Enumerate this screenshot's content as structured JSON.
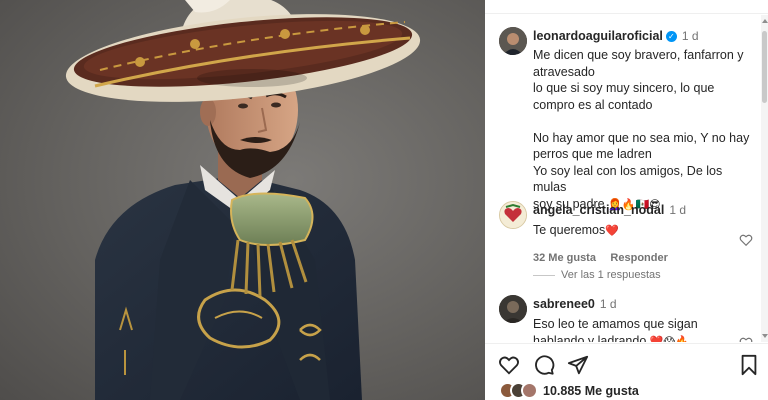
{
  "post": {
    "author": "leonardoaguilaroficial",
    "verified": true,
    "time": "1 d",
    "caption_lines": [
      "Me dicen que soy bravero, fanfarron y",
      "atravesado",
      "lo que si soy muy sincero, lo que",
      "compro es al contado",
      "",
      "No hay amor que no sea mio, Y no hay",
      "perros que me ladren",
      "Yo soy leal con los amigos, De los mulas",
      "soy su padre"
    ],
    "caption_emoji": "👩‍🦰🔥🇲🇽😎"
  },
  "comments": [
    {
      "user": "angela_cristian_nodal",
      "time": "1 d",
      "text": "Te queremos",
      "emoji": "❤️",
      "likes": "32 Me gusta",
      "reply_label": "Responder",
      "view_replies": "Ver las 1 respuestas"
    },
    {
      "user": "sabrenee0",
      "time": "1 d",
      "text_lines": [
        "Eso leo te amamos que sigan",
        "hablando y ladrando"
      ],
      "emoji": "❤️😱🔥"
    }
  ],
  "actions": {
    "like_count": "10.885 Me gusta"
  },
  "icons": [
    "verified-badge-icon",
    "heart-icon",
    "comment-icon",
    "share-icon",
    "bookmark-icon"
  ],
  "colors": {
    "accent": "#0095f6",
    "like_red": "#ed4956",
    "text": "#262626",
    "secondary": "#737373"
  }
}
